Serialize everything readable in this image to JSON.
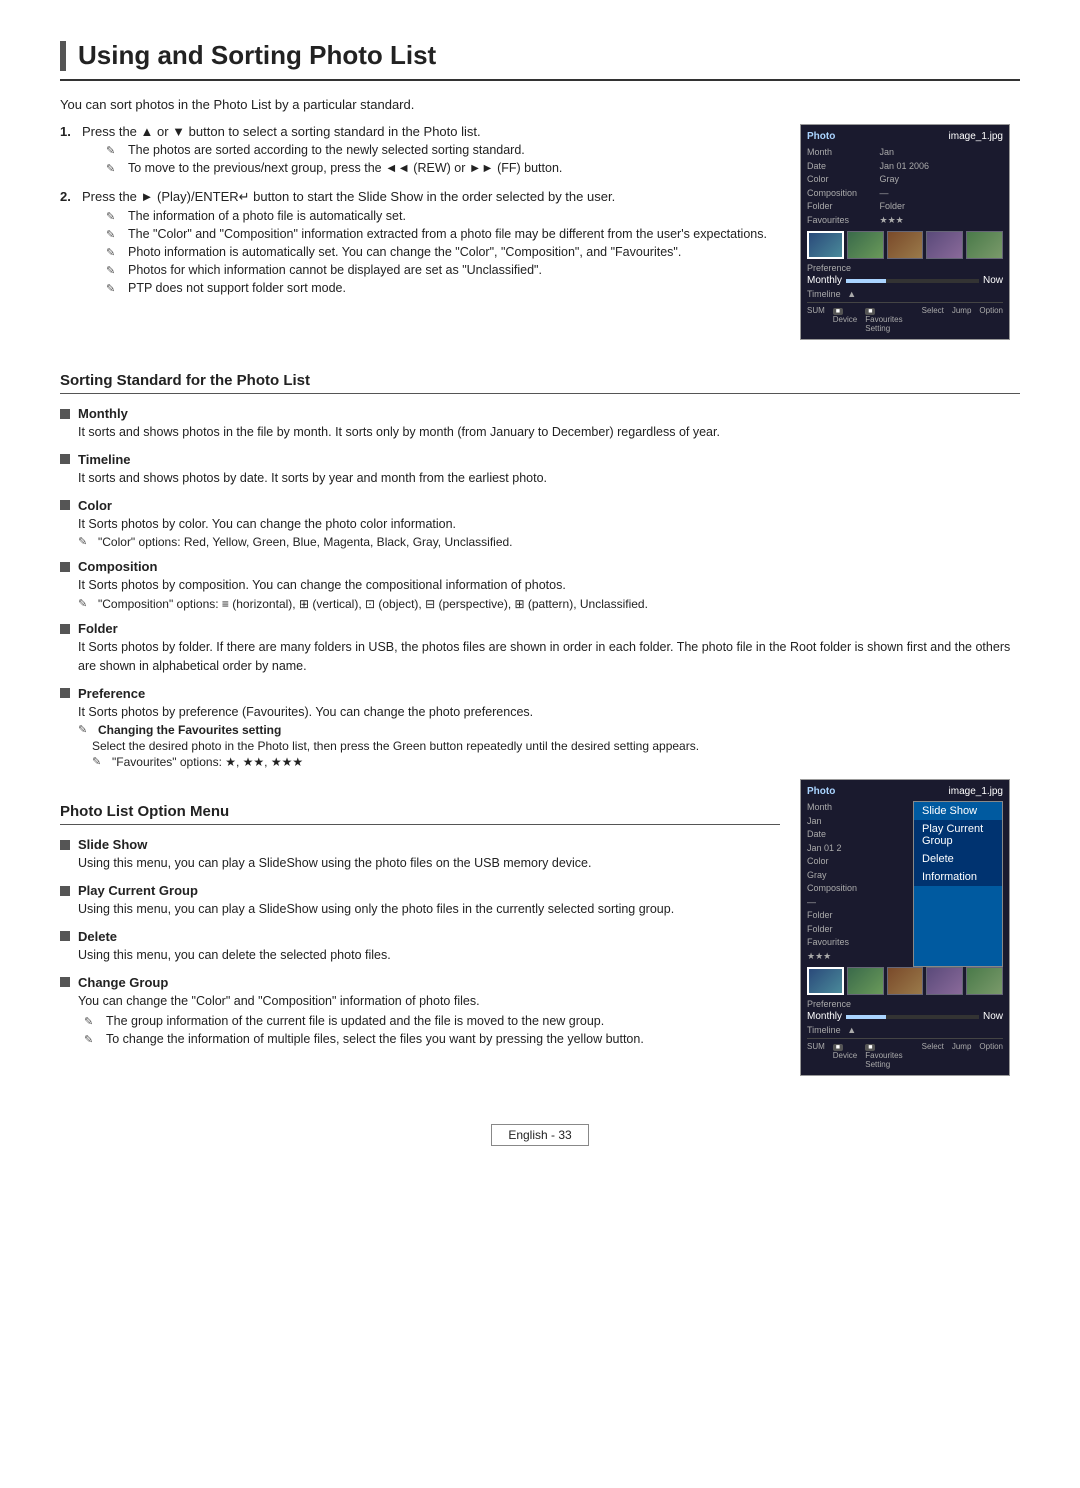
{
  "page": {
    "title": "Using and Sorting Photo List",
    "intro": "You can sort photos in the Photo List by a particular standard.",
    "footer_label": "English - 33"
  },
  "steps": [
    {
      "num": "1.",
      "text": "Press the ▲ or ▼ button to select a sorting standard in the Photo list.",
      "notes": [
        "The photos are sorted according to the newly selected sorting standard.",
        "To move to the previous/next group, press the ◄◄ (REW) or ►► (FF) button."
      ]
    },
    {
      "num": "2.",
      "text": "Press the ► (Play)/ENTER↵ button to start the Slide Show in the order selected by the user.",
      "notes": [
        "The information of a photo file is automatically set.",
        "The \"Color\" and \"Composition\" information extracted from a photo file may be different from the user's expectations.",
        "Photo information is automatically set. You can change the \"Color\", \"Composition\", and \"Favourites\".",
        "Photos for which information cannot be displayed are set as \"Unclassified\".",
        "PTP does not support folder sort mode."
      ]
    }
  ],
  "sorting_section": {
    "title": "Sorting Standard for the Photo List",
    "items": [
      {
        "name": "Monthly",
        "desc": "It sorts and shows photos in the file by month. It sorts only by month (from January to December) regardless of year."
      },
      {
        "name": "Timeline",
        "desc": "It sorts and shows photos by date. It sorts by year and month from the earliest photo."
      },
      {
        "name": "Color",
        "desc": "It Sorts photos by color. You can change the photo color information.",
        "subnote": "\"Color\" options: Red, Yellow, Green, Blue, Magenta, Black, Gray, Unclassified."
      },
      {
        "name": "Composition",
        "desc": "It Sorts photos by composition. You can change the compositional information of photos.",
        "subnote": "\"Composition\" options: ≡ (horizontal), ⊞ (vertical), ⊡ (object), ⊟ (perspective), ⊞ (pattern), Unclassified."
      },
      {
        "name": "Folder",
        "desc": "It Sorts photos by folder. If there are many folders in USB, the photos files are shown in order in each folder. The photo file in the Root folder is shown first and the others are shown in alphabetical order by name."
      },
      {
        "name": "Preference",
        "desc": "It Sorts photos by preference (Favourites). You can change the photo preferences.",
        "subnote_bold": "Changing the Favourites setting",
        "subnote2": "Select the desired photo in the Photo list, then press the Green button repeatedly until the desired setting appears.",
        "subnote3": "\"Favourites\" options: ★, ★★, ★★★"
      }
    ]
  },
  "option_menu_section": {
    "title": "Photo List Option Menu",
    "items": [
      {
        "name": "Slide Show",
        "desc": "Using this menu, you can play a SlideShow using the photo files on the USB memory device."
      },
      {
        "name": "Play Current Group",
        "desc": "Using this menu, you can play a SlideShow using only the photo files in the currently selected sorting group."
      },
      {
        "name": "Delete",
        "desc": "Using this menu, you can delete the selected photo files."
      },
      {
        "name": "Change Group",
        "desc": "You can change the \"Color\" and \"Composition\" information of photo files.",
        "notes": [
          "The group information of the current file is updated and the file is moved to the new group.",
          "To change the information of multiple files, select the files you want by pressing the yellow button."
        ]
      }
    ]
  },
  "photo_ui": {
    "label": "Photo",
    "filename": "image_1.jpg",
    "info": {
      "month": "Jan",
      "date": "Jan 01 2006",
      "color": "Gray",
      "composition": "—",
      "folder": "Folder",
      "favourites": "★★★"
    },
    "preference": "Preference",
    "monthly_label": "Monthly",
    "now_label": "Now",
    "timeline_label": "Timeline",
    "sum_label": "SUM",
    "footer_items": [
      "Device",
      "Favourites Setting",
      "Select",
      "Jump",
      "Option"
    ]
  },
  "photo_ui2": {
    "label": "Photo",
    "filename": "image_1.jpg",
    "menu_items": [
      "Slide Show",
      "Play Current Group",
      "Delete",
      "Information"
    ],
    "selected_menu": 0,
    "info": {
      "month": "Jan",
      "date": "Jan 01 2",
      "color": "Gray",
      "composition": "—",
      "folder": "Folder",
      "favourites": "★★★"
    }
  }
}
